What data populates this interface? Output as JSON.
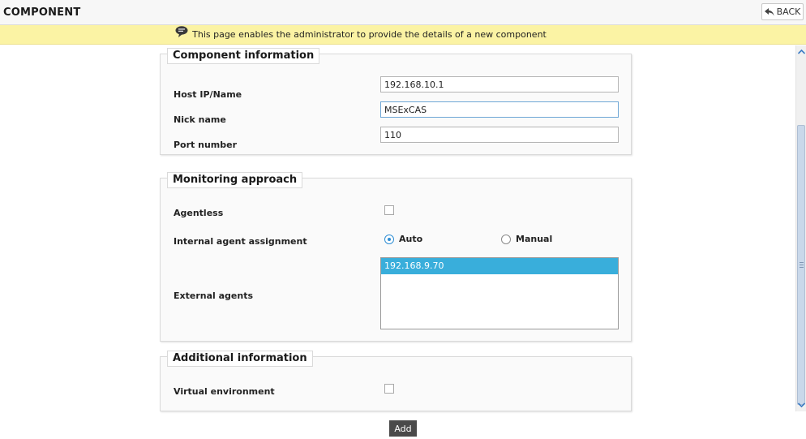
{
  "header": {
    "title": "COMPONENT",
    "back_label": "BACK"
  },
  "info_bar": {
    "text": "This page enables the administrator to provide the details of a new component"
  },
  "component_information": {
    "legend": "Component information",
    "host_label": "Host IP/Name",
    "host_value": "192.168.10.1",
    "nick_label": "Nick name",
    "nick_value": "MSExCAS",
    "port_label": "Port number",
    "port_value": "110"
  },
  "monitoring_approach": {
    "legend": "Monitoring approach",
    "agentless_label": "Agentless",
    "agentless_checked": false,
    "internal_label": "Internal agent assignment",
    "auto_label": "Auto",
    "manual_label": "Manual",
    "selected_assignment": "Auto",
    "external_label": "External agents",
    "external_agents": [
      "192.168.9.70"
    ]
  },
  "additional_information": {
    "legend": "Additional information",
    "virtual_label": "Virtual environment",
    "virtual_checked": false
  },
  "actions": {
    "add_label": "Add"
  },
  "colors": {
    "info_bar_bg": "#fbf3a4",
    "selected_option_bg": "#39aedb",
    "radio_accent": "#2f8ed4",
    "add_button_bg": "#4a4a4a"
  },
  "icons": {
    "back": "back-arrow-icon",
    "info": "speech-bubble-icon",
    "scroll_up": "chevron-up-icon",
    "scroll_down": "chevron-down-icon"
  }
}
